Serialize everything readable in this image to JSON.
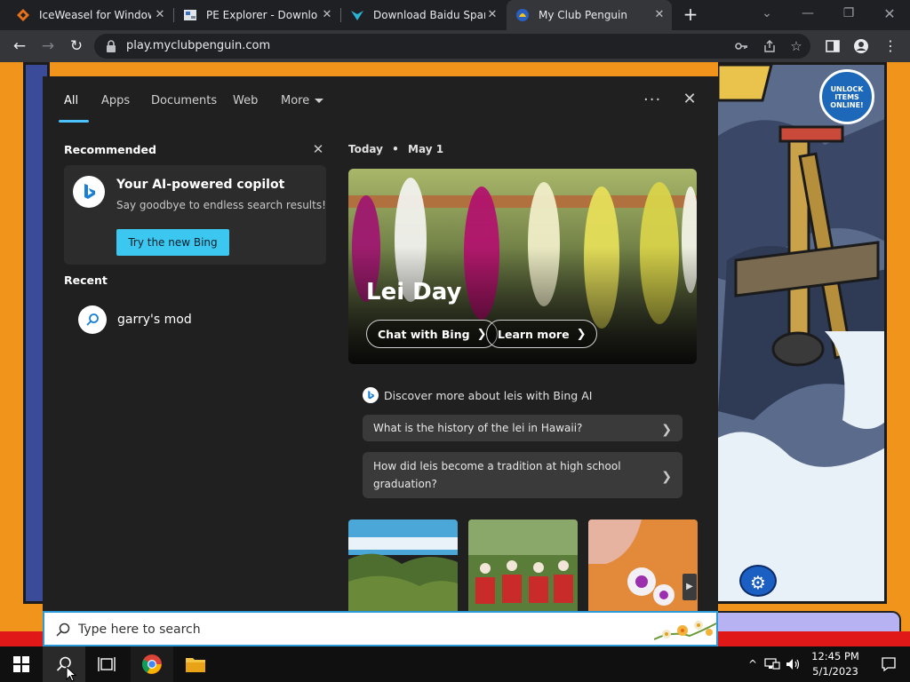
{
  "browser": {
    "tabs": [
      {
        "title": "IceWeasel for Windows",
        "active": false
      },
      {
        "title": "PE Explorer - Downloac",
        "active": false
      },
      {
        "title": "Download Baidu Spark",
        "active": false
      },
      {
        "title": "My Club Penguin",
        "active": true
      }
    ],
    "url": "play.myclubpenguin.com"
  },
  "game": {
    "badge_text": "UNLOCK ITEMS ONLINE!"
  },
  "search_panel": {
    "tabs": [
      "All",
      "Apps",
      "Documents",
      "Web",
      "More"
    ],
    "recommended_heading": "Recommended",
    "copilot": {
      "title": "Your AI-powered copilot",
      "subtitle": "Say goodbye to endless search results!",
      "button": "Try the new Bing"
    },
    "recent_heading": "Recent",
    "recent_items": [
      "garry's mod"
    ],
    "today_label": "Today",
    "date_label": "May 1",
    "hero": {
      "title": "Lei Day",
      "chat_button": "Chat with Bing",
      "learn_button": "Learn more"
    },
    "discover_heading": "Discover more about leis with Bing AI",
    "questions": [
      "What is the history of the lei in Hawaii?",
      "How did leis become a tradition at high school graduation?"
    ]
  },
  "searchbox": {
    "placeholder": "Type here to search"
  },
  "taskbar": {
    "time": "12:45 PM",
    "date": "5/1/2023"
  },
  "colors": {
    "accent": "#4cc2ff",
    "try_button": "#3bc7ef",
    "panel_bg": "#202020",
    "game_orange": "#f0941c"
  }
}
